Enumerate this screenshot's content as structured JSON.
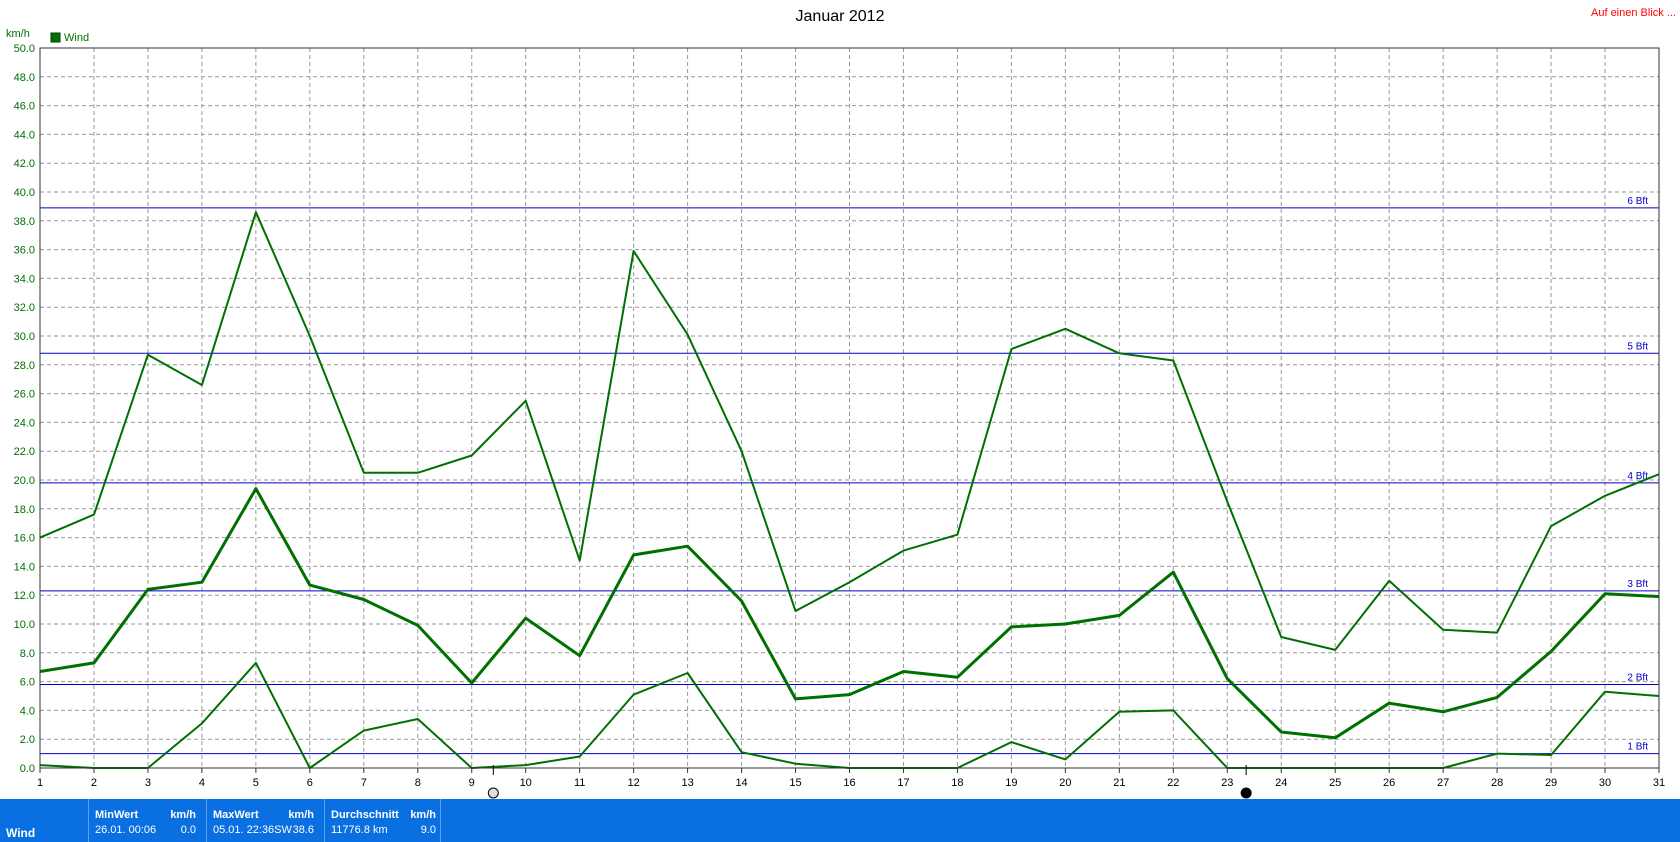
{
  "chart_data": {
    "type": "line",
    "title": "Januar 2012",
    "ylabel": "km/h",
    "ylim": [
      0,
      50
    ],
    "yticks": [
      "0.0",
      "2.0",
      "4.0",
      "6.0",
      "8.0",
      "10.0",
      "12.0",
      "14.0",
      "16.0",
      "18.0",
      "20.0",
      "22.0",
      "24.0",
      "26.0",
      "28.0",
      "30.0",
      "32.0",
      "34.0",
      "36.0",
      "38.0",
      "40.0",
      "42.0",
      "44.0",
      "46.0",
      "48.0",
      "50.0"
    ],
    "x": [
      1,
      2,
      3,
      4,
      5,
      6,
      7,
      8,
      9,
      10,
      11,
      12,
      13,
      14,
      15,
      16,
      17,
      18,
      19,
      20,
      21,
      22,
      23,
      24,
      25,
      26,
      27,
      28,
      29,
      30,
      31
    ],
    "xticks": [
      "1",
      "2",
      "3",
      "4",
      "5",
      "6",
      "7",
      "8",
      "9",
      "10",
      "11",
      "12",
      "13",
      "14",
      "15",
      "16",
      "17",
      "18",
      "19",
      "20",
      "21",
      "22",
      "23",
      "24",
      "25",
      "26",
      "27",
      "28",
      "29",
      "30",
      "31"
    ],
    "legend": [
      "Wind"
    ],
    "legend_position": "top-left",
    "grid": true,
    "series": [
      {
        "role": "max",
        "values": [
          16.0,
          17.6,
          28.7,
          26.6,
          38.6,
          30.0,
          20.5,
          20.5,
          21.7,
          25.5,
          14.4,
          35.9,
          30.1,
          22.0,
          10.9,
          12.9,
          15.1,
          16.2,
          29.1,
          30.5,
          28.8,
          28.3,
          18.5,
          9.1,
          8.2,
          13.0,
          9.6,
          9.4,
          16.8,
          18.9,
          20.4
        ]
      },
      {
        "role": "avg",
        "values": [
          6.7,
          7.3,
          12.4,
          12.9,
          19.4,
          12.7,
          11.7,
          9.9,
          5.9,
          10.4,
          7.8,
          14.8,
          15.4,
          11.6,
          4.8,
          5.1,
          6.7,
          6.3,
          9.8,
          10.0,
          10.6,
          13.6,
          6.2,
          2.5,
          2.1,
          4.5,
          3.9,
          4.9,
          8.1,
          12.1,
          11.9
        ]
      },
      {
        "role": "min",
        "values": [
          0.2,
          0.0,
          0.0,
          3.1,
          7.3,
          0.0,
          2.6,
          3.4,
          0.0,
          0.2,
          0.8,
          5.1,
          6.6,
          1.1,
          0.3,
          0.0,
          0.0,
          0.0,
          1.8,
          0.6,
          3.9,
          4.0,
          0.0,
          0.0,
          0.0,
          0.0,
          0.0,
          1.0,
          0.9,
          5.3,
          5.0
        ]
      }
    ],
    "reference_lines": [
      {
        "label": "1 Bft",
        "value": 1.0
      },
      {
        "label": "2 Bft",
        "value": 5.8
      },
      {
        "label": "3 Bft",
        "value": 12.3
      },
      {
        "label": "4 Bft",
        "value": 19.8
      },
      {
        "label": "5 Bft",
        "value": 28.8
      },
      {
        "label": "6 Bft",
        "value": 38.9
      }
    ],
    "moon_marks": [
      {
        "day": 9.4,
        "icon": "full-moon-icon"
      },
      {
        "day": 23.35,
        "icon": "new-moon-icon"
      }
    ]
  },
  "header": {
    "title": "Januar 2012",
    "unit": "km/h",
    "legend_label": "Wind",
    "link": "Auf einen Blick ..."
  },
  "colors": {
    "series": "#007000",
    "reference": "#0000cc",
    "grid": "#999999",
    "footer": "#0a6fe0",
    "link": "#ff0000"
  },
  "footer": {
    "row_label": "Wind",
    "min": {
      "header": "MinWert",
      "unit": "km/h",
      "when": "26.01.  00:06",
      "value": "0.0"
    },
    "max": {
      "header": "MaxWert",
      "unit": "km/h",
      "when": "05.01.  22:36SW",
      "value": "38.6"
    },
    "avg": {
      "header": "Durchschnitt",
      "unit": "km/h",
      "when": "11776.8 km",
      "value": "9.0"
    }
  }
}
